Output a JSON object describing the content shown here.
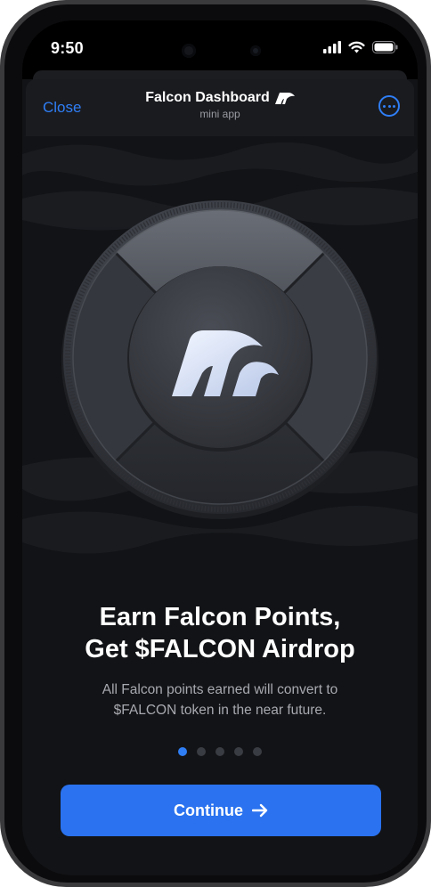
{
  "status_bar": {
    "time": "9:50",
    "icons": [
      "signal-icon",
      "wifi-icon",
      "battery-icon"
    ]
  },
  "header": {
    "close_label": "Close",
    "title": "Falcon Dashboard",
    "subtitle": "mini app",
    "title_icon": "falcon-logo-icon",
    "menu_icon": "more-icon"
  },
  "hero": {
    "image": "falcon-coin",
    "logo_icon": "falcon-logo-icon"
  },
  "content": {
    "headline_line1": "Earn Falcon Points,",
    "headline_line2": "Get $FALCON Airdrop",
    "description_line1": "All Falcon points earned will convert to",
    "description_line2": "$FALCON token in the near future."
  },
  "pagination": {
    "total": 5,
    "current": 1
  },
  "cta": {
    "label": "Continue",
    "icon": "arrow-right-icon"
  },
  "colors": {
    "accent": "#2f7ef5",
    "button": "#2a72ef",
    "background": "#121316",
    "text": "#ffffff",
    "muted_text": "#a7a9b0"
  }
}
